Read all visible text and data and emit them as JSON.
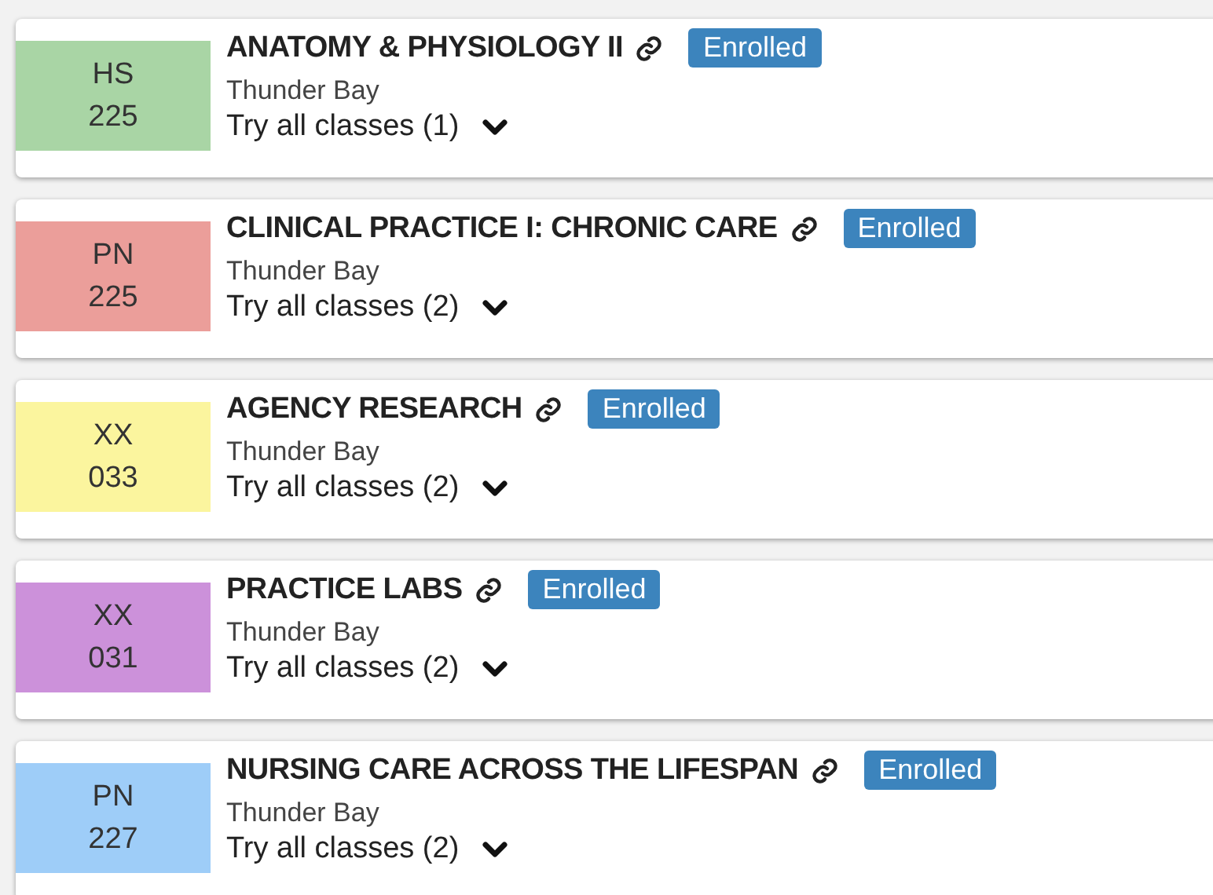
{
  "courses": [
    {
      "subject": "HS",
      "number": "225",
      "color": "#a9d5a5",
      "title": "ANATOMY & PHYSIOLOGY II",
      "status": "Enrolled",
      "campus": "Thunder Bay",
      "classes": "Try all classes (1)"
    },
    {
      "subject": "PN",
      "number": "225",
      "color": "#eb9e9a",
      "title": "CLINICAL PRACTICE I: CHRONIC CARE",
      "status": "Enrolled",
      "campus": "Thunder Bay",
      "classes": "Try all classes (2)"
    },
    {
      "subject": "XX",
      "number": "033",
      "color": "#fbf59e",
      "title": "AGENCY RESEARCH",
      "status": "Enrolled",
      "campus": "Thunder Bay",
      "classes": "Try all classes (2)"
    },
    {
      "subject": "XX",
      "number": "031",
      "color": "#cc91da",
      "title": "PRACTICE LABS",
      "status": "Enrolled",
      "campus": "Thunder Bay",
      "classes": "Try all classes (2)"
    },
    {
      "subject": "PN",
      "number": "227",
      "color": "#9ecdf8",
      "title": "NURSING CARE ACROSS THE LIFESPAN",
      "status": "Enrolled",
      "campus": "Thunder Bay",
      "classes": "Try all classes (2)"
    }
  ]
}
